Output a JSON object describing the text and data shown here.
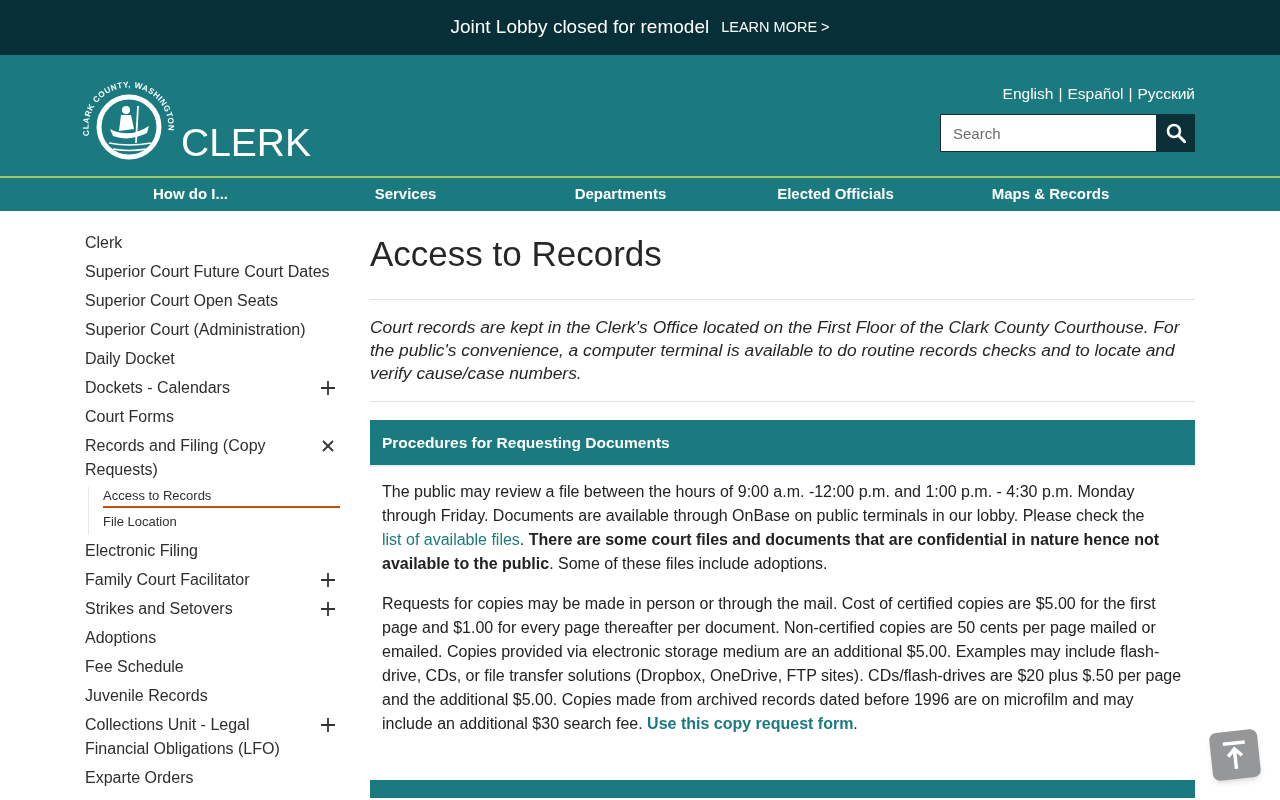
{
  "announcement": {
    "text": "Joint Lobby closed for remodel",
    "link": "LEARN MORE >"
  },
  "header": {
    "seal_text": "CLARK COUNTY, WASHINGTON",
    "site_title": "CLERK",
    "languages": [
      "English",
      "Español",
      "Русский"
    ],
    "language_separator": "|",
    "search": {
      "placeholder": "Search"
    }
  },
  "nav": [
    "How do I...",
    "Services",
    "Departments",
    "Elected Officials",
    "Maps & Records"
  ],
  "sidebar": {
    "items": [
      {
        "label": "Clerk",
        "kind": "link",
        "selected": false
      },
      {
        "label": "Superior Court Future Court Dates",
        "kind": "link",
        "selected": false
      },
      {
        "label": "Superior Court Open Seats",
        "kind": "link",
        "selected": false
      },
      {
        "label": "Superior Court (Administration)",
        "kind": "link",
        "selected": false
      },
      {
        "label": "Daily Docket",
        "kind": "link",
        "selected": false
      },
      {
        "label": "Dockets - Calendars",
        "kind": "group",
        "expanded": false,
        "selected": false
      },
      {
        "label": "Court Forms",
        "kind": "link",
        "selected": false
      },
      {
        "label": "Records and Filing (Copy Requests)",
        "kind": "group",
        "expanded": true,
        "selected": false,
        "children": [
          {
            "label": "Access to Records",
            "selected": true
          },
          {
            "label": "File Location",
            "selected": false
          }
        ]
      },
      {
        "label": "Electronic Filing",
        "kind": "link",
        "selected": false
      },
      {
        "label": "Family Court Facilitator",
        "kind": "group",
        "expanded": false,
        "selected": false
      },
      {
        "label": "Strikes and Setovers",
        "kind": "group",
        "expanded": false,
        "selected": false
      },
      {
        "label": "Adoptions",
        "kind": "link",
        "selected": false
      },
      {
        "label": "Fee Schedule",
        "kind": "link",
        "selected": false
      },
      {
        "label": "Juvenile Records",
        "kind": "link",
        "selected": false
      },
      {
        "label": "Collections Unit - Legal Financial Obligations (LFO)",
        "kind": "group",
        "expanded": false,
        "selected": false
      },
      {
        "label": "Exparte Orders",
        "kind": "link",
        "selected": false
      }
    ]
  },
  "main": {
    "title": "Access to Records",
    "intro": "Court records are kept in the Clerk's Office located on the First Floor of the Clark County Courthouse. For the public's convenience, a computer terminal is available to do routine records checks and to locate and verify cause/case numbers.",
    "sections": [
      {
        "kind": "panel",
        "heading": "Procedures for Requesting Documents",
        "paragraphs": [
          [
            {
              "kind": "text",
              "text": "The public may review a file between the hours of 9:00 a.m. -12:00 p.m. and 1:00 p.m. - 4:30 p.m. Monday through Friday. Documents are available through OnBase on public terminals in our lobby. Please check the "
            },
            {
              "kind": "link",
              "text": "list of available files",
              "bold": false
            },
            {
              "kind": "text",
              "text": ". **There are some court files and documents that are confidential in nature hence not available to the public**. Some of these files include adoptions."
            }
          ],
          [
            {
              "kind": "text",
              "text": "Requests for copies may be made in person or through the mail. Cost of certified copies are $5.00 for the first page and $1.00 for every page thereafter per document. Non-certified copies are 50 cents per page mailed or emailed. Copies provided via electronic storage medium are an additional $5.00. Examples may include flash-drive, CDs, or file transfer solutions (Dropbox, OneDrive, FTP sites).  CDs/flash-drives are $20 plus $.50 per page and the additional $5.00. Copies made from archived records dated before 1996 are on microfilm and may include an additional $30 search fee. "
            },
            {
              "kind": "link",
              "text": "Use this copy request form",
              "bold": true
            },
            {
              "kind": "text",
              "text": "."
            }
          ]
        ]
      },
      {
        "kind": "cut_off"
      }
    ]
  }
}
